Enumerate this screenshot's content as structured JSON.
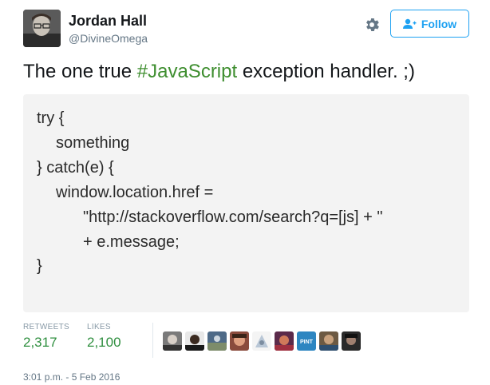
{
  "author": {
    "display_name": "Jordan Hall",
    "handle": "@DivineOmega"
  },
  "actions": {
    "follow_label": "Follow"
  },
  "tweet": {
    "text_before": "The one true ",
    "hashtag": "#JavaScript",
    "text_after": " exception handler. ;)",
    "hashtag_color": "#3e8e2f"
  },
  "code_image": {
    "lines": [
      "try {",
      "something",
      "} catch(e) {",
      "window.location.href =",
      "\"http://stackoverflow.com/search?q=[js] + \"",
      "+ e.message;",
      "}"
    ]
  },
  "stats": {
    "retweets_label": "RETWEETS",
    "retweets_count": "2,317",
    "likes_label": "LIKES",
    "likes_count": "2,100",
    "count_color": "#2f8f3f"
  },
  "likers": {
    "pint_label": "PINT",
    "avatars": [
      "liker-avatar",
      "liker-avatar",
      "liker-avatar",
      "liker-avatar",
      "liker-avatar",
      "liker-avatar",
      "liker-avatar",
      "liker-avatar",
      "liker-avatar"
    ]
  },
  "timestamp": "3:01 p.m. - 5 Feb 2016",
  "colors": {
    "accent": "#1da1f2",
    "text": "#14171a",
    "muted": "#657786"
  }
}
